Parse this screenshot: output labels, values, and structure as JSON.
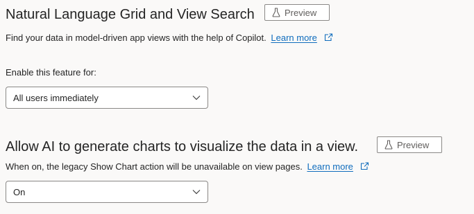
{
  "section1": {
    "title": "Natural Language Grid and View Search",
    "preview_label": "Preview",
    "description": "Find your data in model-driven app views with the help of Copilot.",
    "learn_more": "Learn more",
    "field_label": "Enable this feature for:",
    "select_value": "All users immediately"
  },
  "section2": {
    "title": "Allow AI to generate charts to visualize the data in a view.",
    "preview_label": "Preview",
    "description": "When on, the legacy Show Chart action will be unavailable on view pages.",
    "learn_more": "Learn more",
    "select_value": "On"
  },
  "icons": {
    "preview": "flask-icon",
    "external_link": "external-link-icon",
    "dropdown": "chevron-down-icon"
  },
  "colors": {
    "link": "#0f6cbd",
    "text": "#242424",
    "border": "#8a8886",
    "background": "#faf9f8"
  }
}
